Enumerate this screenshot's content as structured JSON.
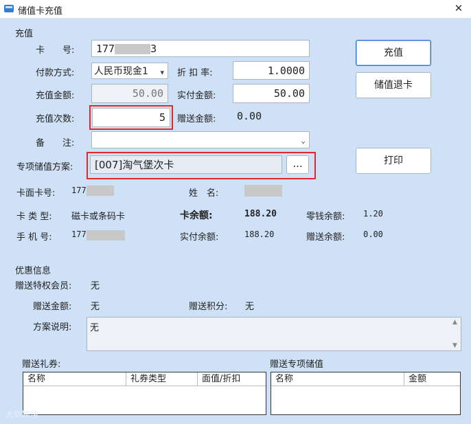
{
  "window": {
    "title": "储值卡充值",
    "close_glyph": "✕"
  },
  "section": {
    "recharge": "充值",
    "discount": "优惠信息"
  },
  "form": {
    "card_no_label": "卡　　号:",
    "card_no_prefix": "177",
    "card_no_suffix": "3",
    "payment_label": "付款方式:",
    "payment_value": "人民币现金1",
    "discount_rate_label": "折 扣 率:",
    "discount_rate_value": "1.0000",
    "recharge_amount_label": "充值金额:",
    "recharge_amount_value": "50.00",
    "actual_pay_label": "实付金额:",
    "actual_pay_value": "50.00",
    "recharge_times_label": "充值次数:",
    "recharge_times_value": "5",
    "gift_amount_label": "赠送金额:",
    "gift_amount_value": "0.00",
    "remark_label": "备　　注:",
    "remark_value": "",
    "plan_label": "专项储值方案:",
    "plan_value": "[007]淘气堡次卡",
    "plan_browse": "..."
  },
  "buttons": {
    "recharge": "充值",
    "refund": "储值退卡",
    "print": "打印"
  },
  "info": {
    "face_no_label": "卡面卡号:",
    "face_no_prefix": "177",
    "name_label": "姓　名:",
    "card_type_label": "卡 类 型:",
    "card_type_value": "磁卡或条码卡",
    "balance_label": "卡余额:",
    "balance_value": "188.20",
    "change_balance_label": "零钱余额:",
    "change_balance_value": "1.20",
    "phone_label": "手 机 号:",
    "phone_prefix": "177",
    "actual_balance_label": "实付余额:",
    "actual_balance_value": "188.20",
    "gift_balance_label": "赠送余额:",
    "gift_balance_value": "0.00"
  },
  "promo": {
    "vip_label": "赠送特权会员:",
    "vip_value": "无",
    "gift_amount_label": "赠送金额:",
    "gift_amount_value": "无",
    "gift_points_label": "赠送积分:",
    "gift_points_value": "无",
    "plan_desc_label": "方案说明:",
    "plan_desc_value": "无"
  },
  "coupons": {
    "title": "赠送礼券:",
    "columns": [
      "名称",
      "礼券类型",
      "面值/折扣"
    ]
  },
  "special": {
    "title": "赠送专项储值",
    "columns": [
      "名称",
      "金额"
    ]
  },
  "watermark": "大数跨境"
}
